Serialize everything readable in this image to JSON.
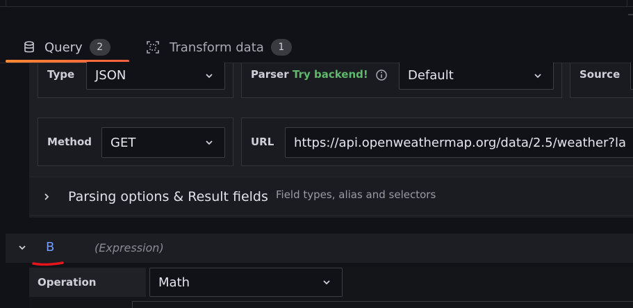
{
  "tabs": [
    {
      "label": "Query",
      "count": "2",
      "icon": "database-icon"
    },
    {
      "label": "Transform data",
      "count": "1",
      "icon": "transform-icon"
    }
  ],
  "query": {
    "type_label": "Type",
    "type_value": "JSON",
    "parser_label": "Parser",
    "parser_try": "Try backend!",
    "parser_value": "Default",
    "source_label": "Source",
    "method_label": "Method",
    "method_value": "GET",
    "url_label": "URL",
    "url_value": "https://api.openweathermap.org/data/2.5/weather?la"
  },
  "parsing": {
    "title": "Parsing options & Result fields",
    "subtitle": "Field types, alias and selectors"
  },
  "expression": {
    "letter": "B",
    "label": "(Expression)",
    "operation_label": "Operation",
    "operation_value": "Math"
  },
  "colors": {
    "accent_gradient_start": "#ff8833",
    "accent_gradient_end": "#f55f3e",
    "try_backend": "#5fb86b",
    "query_letter": "#6e9fff",
    "annotation_red": "#e8141c"
  }
}
